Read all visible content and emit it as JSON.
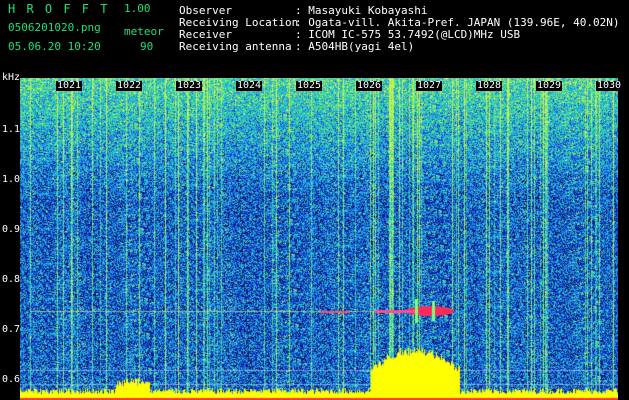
{
  "header": {
    "app_title": "H R O F F T",
    "version": "1.00",
    "file_name": "0506201020.png",
    "mode": "meteor",
    "datetime": "05.06.20 10:20",
    "count": "90"
  },
  "info": {
    "observer_label": "Observer",
    "observer_value": ": Masayuki Kobayashi",
    "location_label": "Receiving Location",
    "location_value": ": Ogata-vill. Akita-Pref. JAPAN (139.96E, 40.02N)",
    "receiver_label": "Receiver",
    "receiver_value": ": ICOM IC-575 53.7492(@LCD)MHz USB",
    "antenna_label": "Receiving antenna",
    "antenna_value": ": A504HB(yagi 4el)"
  },
  "yaxis": {
    "unit": "kHz",
    "ticks": [
      "1.1",
      "1.0",
      "0.9",
      "0.8",
      "0.7",
      "0.6"
    ]
  },
  "xaxis": {
    "ticks": [
      "1021",
      "1022",
      "1023",
      "1024",
      "1025",
      "1026",
      "1027",
      "1028",
      "1029",
      "1030"
    ]
  },
  "colors": {
    "text_green": "#18e27a",
    "text_white": "#ffffff",
    "tick_yellow": "#ffe600",
    "noise_floor": "#0a1d8a",
    "echo_red": "#ff2a5a",
    "level_bar": "#ffff00"
  }
}
